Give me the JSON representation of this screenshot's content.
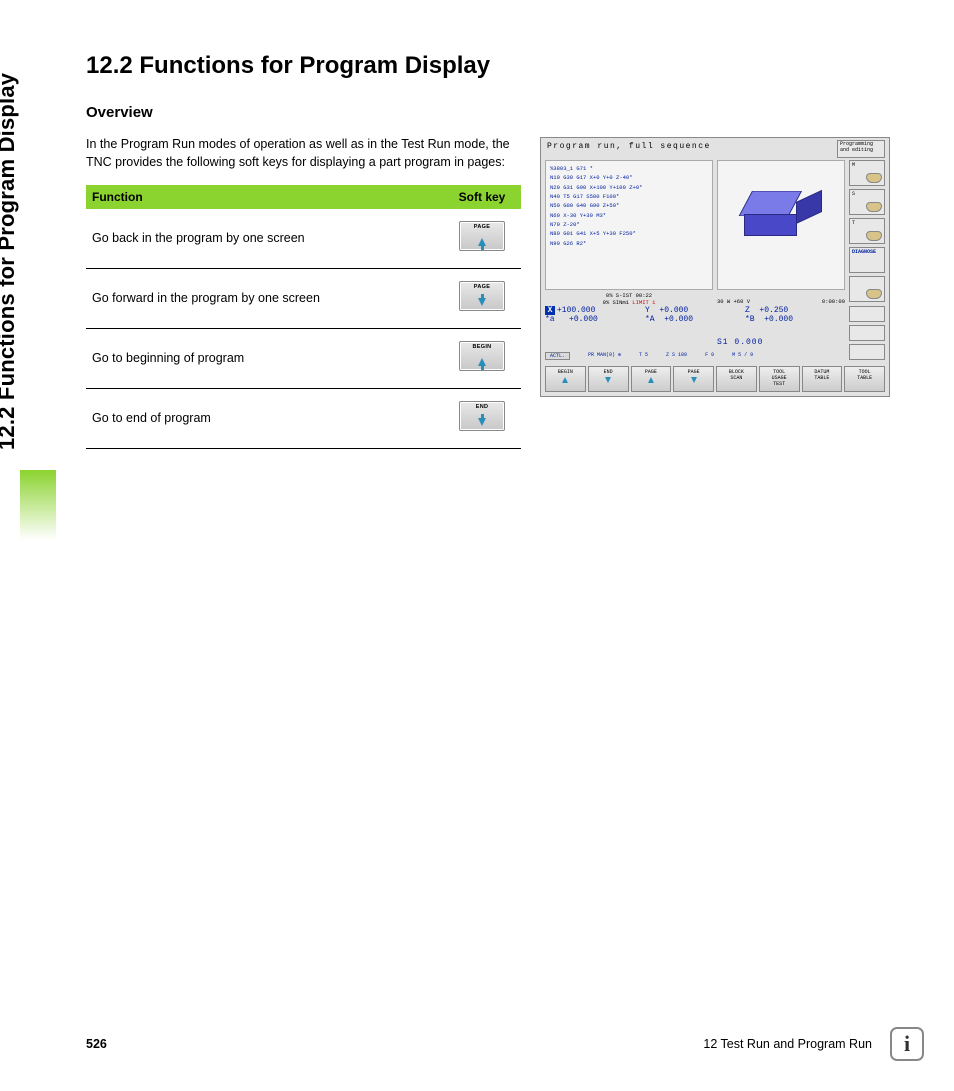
{
  "side_heading": "12.2 Functions for Program Display",
  "heading": "12.2 Functions for Program Display",
  "subheading": "Overview",
  "intro": "In the Program Run modes of operation as well as in the Test Run mode, the TNC provides the following soft keys for displaying a part program in pages:",
  "table": {
    "headers": {
      "function": "Function",
      "softkey": "Soft key"
    },
    "rows": [
      {
        "func": "Go back in the program by one screen",
        "key_label": "PAGE",
        "dir": "up"
      },
      {
        "func": "Go forward in the program by one screen",
        "key_label": "PAGE",
        "dir": "down"
      },
      {
        "func": "Go to beginning of program",
        "key_label": "BEGIN",
        "dir": "up"
      },
      {
        "func": "Go to end of program",
        "key_label": "END",
        "dir": "down"
      }
    ]
  },
  "screenshot": {
    "title": "Program run, full sequence",
    "mode_box": "Programming and editing",
    "code_lines": "%3803_1 G71 *\nN10 G30 G17 X+0 Y+0 Z-40*\nN20 G31 G90 X+100 Y+100 Z+0*\nN40 T5 G17 S500 F100*\nN50 G00 G40 G90 Z+50*\nN60 X-30 Y+30 M3*\nN70 Z-20*\nN80 G01 G41 X+5 Y+30 F250*\nN90 G26 R2*",
    "status_line_1": "0% S-IST 00:22",
    "status_line_2_a": "0% SINm1 ",
    "status_line_2_b": "LIMIT 1",
    "info_right": {
      "a": "30 W +60 V",
      "b": "0:00:00"
    },
    "coords": {
      "x": {
        "label": "X",
        "val": "+100.000"
      },
      "y": {
        "label": "Y",
        "val": "+0.000"
      },
      "z": {
        "label": "Z",
        "val": "+0.250"
      },
      "a": {
        "label": "*a",
        "val": "+0.000"
      },
      "A": {
        "label": "*A",
        "val": "+0.000"
      },
      "B": {
        "label": "*B",
        "val": "+0.000"
      }
    },
    "s1": "S1   0.000",
    "actl": {
      "a": "ACTL.",
      "b": "PR MAN(0) ⊕",
      "c": "T 5",
      "d": "Z S 100",
      "e": "F 0",
      "f": "M 5 / 9"
    },
    "side_icons": [
      {
        "label": "M"
      },
      {
        "label": "S"
      },
      {
        "label": "T"
      },
      {
        "label_diag": "DIAGNOSE"
      },
      {
        "blob": true
      }
    ],
    "softkeys": [
      {
        "l1": "BEGIN",
        "dir": "up"
      },
      {
        "l1": "END",
        "dir": "down"
      },
      {
        "l1": "PAGE",
        "dir": "up"
      },
      {
        "l1": "PAGE",
        "dir": "down"
      },
      {
        "l1": "BLOCK",
        "l2": "SCAN"
      },
      {
        "l1": "TOOL",
        "l2": "USAGE",
        "l3": "TEST"
      },
      {
        "l1": "DATUM",
        "l2": "TABLE"
      },
      {
        "l1": "TOOL",
        "l2": "TABLE"
      }
    ]
  },
  "footer": {
    "page": "526",
    "chapter": "12 Test Run and Program Run"
  }
}
